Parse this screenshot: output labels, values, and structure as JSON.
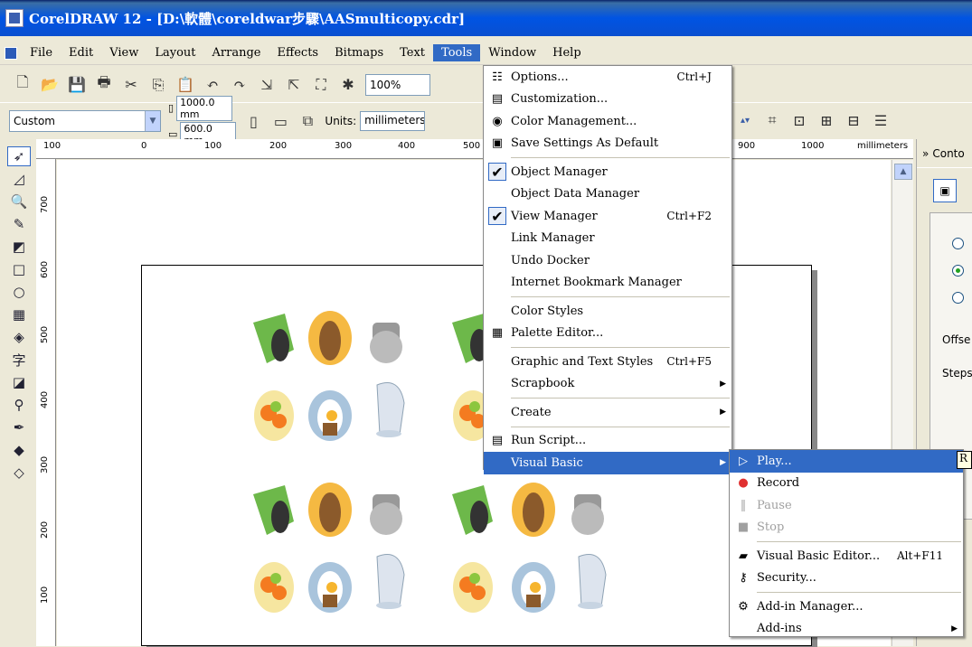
{
  "window": {
    "title": "CorelDRAW 12 - [D:\\軟體\\coreldwar步驟\\AASmulticopy.cdr]"
  },
  "menubar": [
    {
      "label": "File"
    },
    {
      "label": "Edit"
    },
    {
      "label": "View"
    },
    {
      "label": "Layout"
    },
    {
      "label": "Arrange"
    },
    {
      "label": "Effects"
    },
    {
      "label": "Bitmaps"
    },
    {
      "label": "Text"
    },
    {
      "label": "Tools"
    },
    {
      "label": "Window"
    },
    {
      "label": "Help"
    }
  ],
  "toolbar": {
    "zoom": "100%"
  },
  "propertybar": {
    "paper": "Custom",
    "width": "1000.0 mm",
    "height": "600.0 mm",
    "units_label": "Units:",
    "units_value": "millimeters"
  },
  "ruler": {
    "top": [
      "100",
      "0",
      "100",
      "200",
      "300",
      "400",
      "500",
      "900",
      "1000",
      "millimeters"
    ],
    "left": [
      "700",
      "600",
      "500",
      "400",
      "300",
      "200",
      "100"
    ]
  },
  "docker": {
    "title": "Conto",
    "offset": "Offse",
    "steps": "Steps"
  },
  "tools_menu": {
    "items": [
      {
        "label": "Options...",
        "shortcut": "Ctrl+J"
      },
      {
        "label": "Customization...",
        "shortcut": ""
      },
      {
        "label": "Color Management...",
        "shortcut": ""
      },
      {
        "label": "Save Settings As Default",
        "shortcut": ""
      },
      {
        "label": "Object Manager",
        "shortcut": ""
      },
      {
        "label": "Object Data Manager",
        "shortcut": ""
      },
      {
        "label": "View Manager",
        "shortcut": "Ctrl+F2"
      },
      {
        "label": "Link Manager",
        "shortcut": ""
      },
      {
        "label": "Undo Docker",
        "shortcut": ""
      },
      {
        "label": "Internet Bookmark Manager",
        "shortcut": ""
      },
      {
        "label": "Color Styles",
        "shortcut": ""
      },
      {
        "label": "Palette Editor...",
        "shortcut": ""
      },
      {
        "label": "Graphic and Text Styles",
        "shortcut": "Ctrl+F5"
      },
      {
        "label": "Scrapbook",
        "shortcut": ""
      },
      {
        "label": "Create",
        "shortcut": ""
      },
      {
        "label": "Run Script...",
        "shortcut": ""
      },
      {
        "label": "Visual Basic",
        "shortcut": ""
      }
    ]
  },
  "vb_menu": {
    "items": [
      {
        "label": "Play...",
        "shortcut": ""
      },
      {
        "label": "Record",
        "shortcut": ""
      },
      {
        "label": "Pause",
        "shortcut": ""
      },
      {
        "label": "Stop",
        "shortcut": ""
      },
      {
        "label": "Visual Basic Editor...",
        "shortcut": "Alt+F11"
      },
      {
        "label": "Security...",
        "shortcut": ""
      },
      {
        "label": "Add-in Manager...",
        "shortcut": ""
      },
      {
        "label": "Add-ins",
        "shortcut": ""
      }
    ],
    "tooltip": "R"
  },
  "colors": {
    "highlight": "#316ac5",
    "titlebar": "#0054e3"
  }
}
